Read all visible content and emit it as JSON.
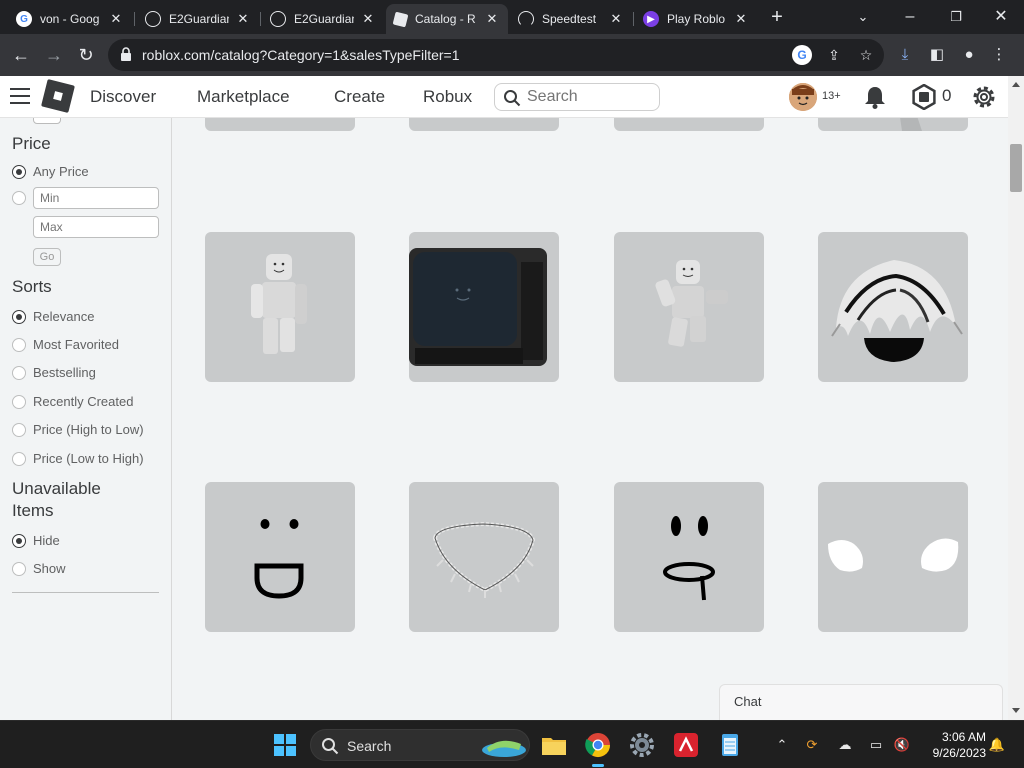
{
  "browser": {
    "tabs": [
      {
        "title": "von - Goog",
        "favicon": "google-icon",
        "active": false
      },
      {
        "title": "E2Guardian",
        "favicon": "globe-icon",
        "active": false
      },
      {
        "title": "E2Guardian",
        "favicon": "globe-icon",
        "active": false
      },
      {
        "title": "Catalog - R",
        "favicon": "roblox-icon",
        "active": true
      },
      {
        "title": "Speedtest",
        "favicon": "speedtest-icon",
        "active": false
      },
      {
        "title": "Play Roblo",
        "favicon": "play-icon",
        "active": false
      }
    ],
    "url": "roblox.com/catalog?Category=1&salesTypeFilter=1"
  },
  "nav": {
    "links": [
      "Discover",
      "Marketplace",
      "Create",
      "Robux"
    ],
    "search_placeholder": "Search",
    "age_badge": "13+",
    "robux_count": "0"
  },
  "sidebar": {
    "price_heading": "Price",
    "price_options": [
      {
        "label": "Any Price",
        "checked": true
      }
    ],
    "min_placeholder": "Min",
    "max_placeholder": "Max",
    "go_label": "Go",
    "sorts_heading": "Sorts",
    "sort_options": [
      {
        "label": "Relevance",
        "checked": true
      },
      {
        "label": "Most Favorited",
        "checked": false
      },
      {
        "label": "Bestselling",
        "checked": false
      },
      {
        "label": "Recently Created",
        "checked": false
      },
      {
        "label": "Price (High to Low)",
        "checked": false
      },
      {
        "label": "Price (Low to High)",
        "checked": false
      }
    ],
    "unavailable_heading_line1": "Unavailable",
    "unavailable_heading_line2": "Items",
    "unavailable_options": [
      {
        "label": "Hide",
        "checked": true
      },
      {
        "label": "Show",
        "checked": false
      }
    ]
  },
  "catalog": {
    "items": [
      {
        "name": "partial-item",
        "row": 0
      },
      {
        "name": "partial-item",
        "row": 0
      },
      {
        "name": "partial-item",
        "row": 0
      },
      {
        "name": "partial-item",
        "row": 0
      },
      {
        "name": "blank-avatar-body",
        "row": 1
      },
      {
        "name": "tv-head",
        "row": 1
      },
      {
        "name": "waving-avatar-body",
        "row": 1
      },
      {
        "name": "black-white-hair",
        "row": 1
      },
      {
        "name": "open-smile-face",
        "row": 2
      },
      {
        "name": "spiked-necklace",
        "row": 2
      },
      {
        "name": "drool-face",
        "row": 2
      },
      {
        "name": "white-wings",
        "row": 2
      }
    ]
  },
  "chat": {
    "label": "Chat"
  },
  "taskbar": {
    "search_label": "Search",
    "time": "3:06 AM",
    "date": "9/26/2023"
  }
}
